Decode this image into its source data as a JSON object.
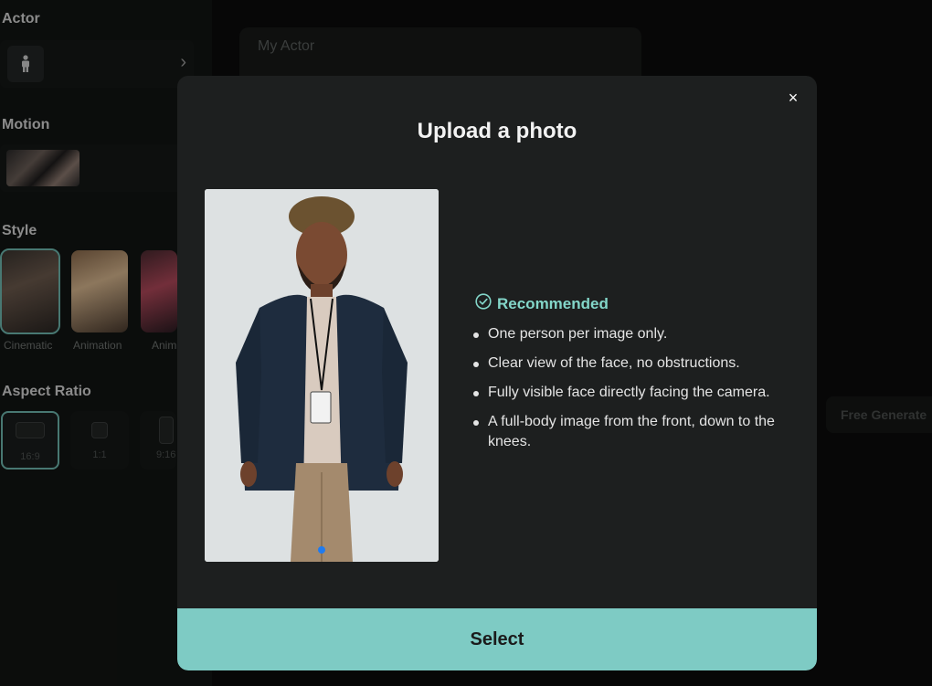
{
  "left_panel": {
    "actor_title": "Actor",
    "motion_title": "Motion",
    "style_title": "Style",
    "styles": [
      {
        "label": "Cinematic",
        "selected": true
      },
      {
        "label": "Animation",
        "selected": false
      },
      {
        "label": "Anim",
        "selected": false
      }
    ],
    "aspect_title": "Aspect Ratio",
    "ratios": [
      {
        "label": "16:9",
        "selected": true
      },
      {
        "label": "1:1",
        "selected": false
      },
      {
        "label": "9:16",
        "selected": false
      }
    ]
  },
  "main": {
    "my_actor_label": "My Actor",
    "free_generate_label": "Free Generate"
  },
  "modal": {
    "close_glyph": "×",
    "title": "Upload a photo",
    "recommended_label": "Recommended",
    "tips": [
      "One person per image only.",
      "Clear view of the face, no obstructions.",
      "Fully visible face directly facing the camera.",
      "A full-body image from the front, down to the knees."
    ],
    "select_label": "Select",
    "carousel": {
      "active_index": 0,
      "count": 1
    }
  },
  "colors": {
    "accent": "#7ecbc4",
    "recommended": "#83d6c9",
    "modal_bg": "#1d1f1f",
    "carousel_dot": "#1f7bf0"
  }
}
